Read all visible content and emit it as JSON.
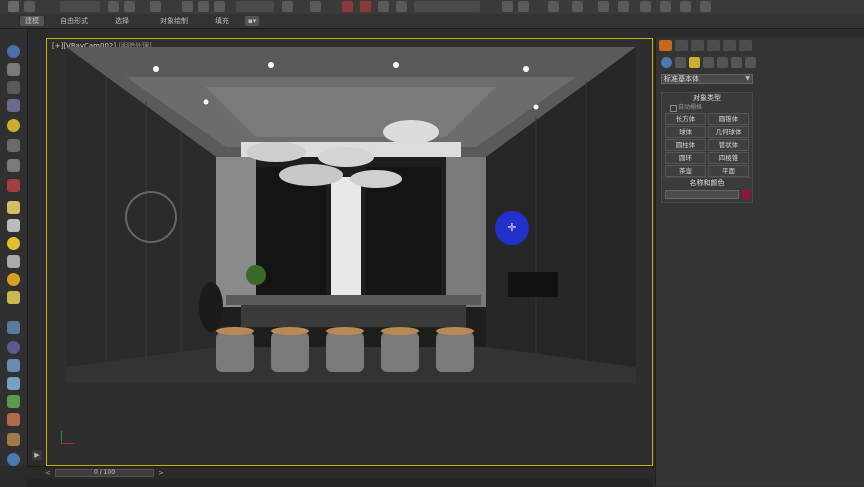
{
  "ribbon": {
    "tabs": [
      "建模",
      "自由形式",
      "选择",
      "对象绘制",
      "填充"
    ]
  },
  "viewport": {
    "label_prefix": "[+][VRayCam002]",
    "label_mode": "[明暗处理]"
  },
  "timeline": {
    "frame_label": "0 / 100"
  },
  "panel": {
    "category_dropdown": "标准基本体",
    "object_type": {
      "title": "对象类型",
      "auto_grid": "自动栅格",
      "buttons": [
        "长方体",
        "圆锥体",
        "球体",
        "几何球体",
        "圆柱体",
        "管状体",
        "圆环",
        "四棱锥",
        "茶壶",
        "平面"
      ]
    },
    "name_color": {
      "title": "名称和颜色",
      "swatch_color": "#9a1030"
    }
  },
  "colors": {
    "viewport_border": "#c8b400",
    "cursor_highlight": "#2233dd"
  },
  "icons": [
    "gear-icon",
    "sun-icon",
    "camera-icon",
    "light-icon",
    "shape-icon",
    "hammer-icon",
    "move-icon",
    "rotate-icon",
    "scale-icon",
    "crosshair-icon",
    "play-icon"
  ]
}
